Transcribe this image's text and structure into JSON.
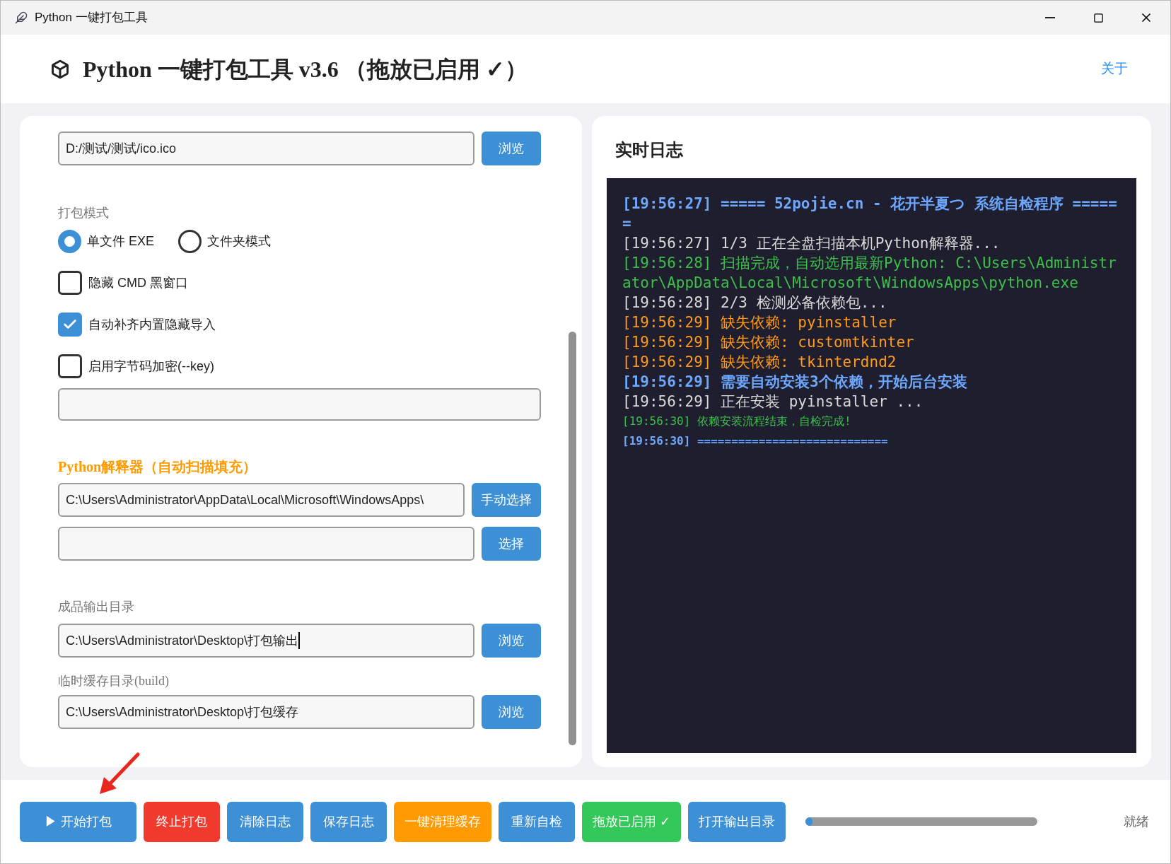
{
  "window": {
    "title": "Python 一键打包工具"
  },
  "header": {
    "title": "Python 一键打包工具 v3.6 （拖放已启用 ✓）",
    "about_link": "关于"
  },
  "form": {
    "icon_path": {
      "value": "D:/测试/测试/ico.ico",
      "button": "浏览"
    },
    "mode": {
      "label": "打包模式",
      "options": [
        {
          "label": "单文件 EXE",
          "selected": true
        },
        {
          "label": "文件夹模式",
          "selected": false
        }
      ]
    },
    "checkboxes": [
      {
        "label": "隐藏 CMD 黑窗口",
        "checked": false
      },
      {
        "label": "自动补齐内置隐藏导入",
        "checked": true
      },
      {
        "label": "启用字节码加密(--key)",
        "checked": false
      }
    ],
    "interpreter": {
      "label": "Python解释器（自动扫描填充）",
      "value": "C:\\Users\\Administrator\\AppData\\Local\\Microsoft\\WindowsApps\\",
      "button": "手动选择",
      "second_button": "选择"
    },
    "output_dir": {
      "label": "成品输出目录",
      "value": "C:\\Users\\Administrator\\Desktop\\打包输出",
      "button": "浏览"
    },
    "temp_dir": {
      "label": "临时缓存目录(build)",
      "value": "C:\\Users\\Administrator\\Desktop\\打包缓存",
      "button": "浏览"
    }
  },
  "log": {
    "title": "实时日志",
    "lines": [
      {
        "kind": "title",
        "text": "[19:56:27] ===== 52pojie.cn - 花开半夏つ 系统自检程序 ======"
      },
      {
        "kind": "plain",
        "text": "[19:56:27] 1/3 正在全盘扫描本机Python解释器..."
      },
      {
        "kind": "success",
        "text": "[19:56:28] 扫描完成，自动选用最新Python: C:\\Users\\Administrator\\AppData\\Local\\Microsoft\\WindowsApps\\python.exe"
      },
      {
        "kind": "plain",
        "text": "[19:56:28] 2/3 检测必备依赖包..."
      },
      {
        "kind": "warning",
        "text": "[19:56:29] 缺失依赖: pyinstaller"
      },
      {
        "kind": "warning",
        "text": "[19:56:29] 缺失依赖: customtkinter"
      },
      {
        "kind": "warning",
        "text": "[19:56:29] 缺失依赖: tkinterdnd2"
      },
      {
        "kind": "title",
        "text": "[19:56:29] 需要自动安装3个依赖，开始后台安装"
      },
      {
        "kind": "plain",
        "text": "[19:56:29] 正在安装 pyinstaller ..."
      },
      {
        "kind": "small-success",
        "text": "[19:56:30] 依赖安装流程结束，自检完成!"
      },
      {
        "kind": "small-title",
        "text": "[19:56:30] ============================"
      }
    ]
  },
  "toolbar": {
    "buttons": [
      {
        "label": "▶ 开始打包",
        "color": "#3d8fd6"
      },
      {
        "label": "终止打包",
        "color": "#f03a2e"
      },
      {
        "label": "清除日志",
        "color": "#3d8fd6"
      },
      {
        "label": "保存日志",
        "color": "#3d8fd6"
      },
      {
        "label": "一键清理缓存",
        "color": "#ff9a00"
      },
      {
        "label": "重新自检",
        "color": "#3d8fd6"
      },
      {
        "label": "拖放已启用 ✓",
        "color": "#34c759"
      },
      {
        "label": "打开输出目录",
        "color": "#3d8fd6"
      }
    ],
    "progress": {
      "level": 0.03
    },
    "status": "就绪"
  }
}
